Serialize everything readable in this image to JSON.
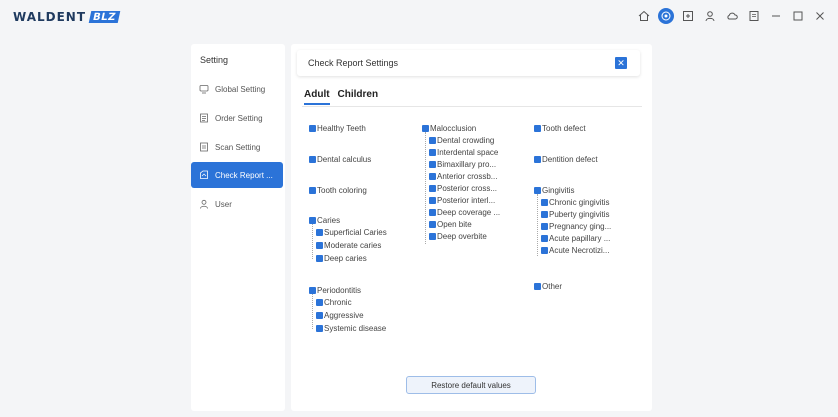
{
  "app": {
    "brand": "WALDENT",
    "brand_badge": "BLZ"
  },
  "top_icons": [
    "home-icon",
    "target-icon",
    "screen-icon",
    "user-icon",
    "cloud-icon",
    "document-icon",
    "minimize-icon",
    "maximize-icon",
    "close-icon"
  ],
  "sidebar": {
    "title": "Setting",
    "items": [
      {
        "label": "Global Setting",
        "icon": "monitor-icon"
      },
      {
        "label": "Order Setting",
        "icon": "list-icon"
      },
      {
        "label": "Scan Setting",
        "icon": "file-icon"
      },
      {
        "label": "Check Report ...",
        "icon": "report-icon",
        "active": true
      },
      {
        "label": "User",
        "icon": "user-icon"
      }
    ]
  },
  "panel": {
    "title": "Check Report Settings",
    "tabs": [
      {
        "label": "Adult",
        "active": true
      },
      {
        "label": "Children",
        "active": false
      }
    ],
    "col1": {
      "healthy": "Healthy Teeth",
      "calculus": "Dental calculus",
      "coloring": "Tooth coloring",
      "caries": "Caries",
      "caries_children": [
        "Superficial Caries",
        "Moderate caries",
        "Deep caries"
      ],
      "perio": "Periodontitis",
      "perio_children": [
        "Chronic",
        "Aggressive",
        "Systemic disease"
      ]
    },
    "col2": {
      "malocclusion": "Malocclusion",
      "malocclusion_children": [
        "Dental crowding",
        "Interdental space",
        "Bimaxillary pro...",
        "Anterior crossb...",
        "Posterior cross...",
        "Posterior interl...",
        "Deep coverage ...",
        "Open bite",
        "Deep overbite"
      ]
    },
    "col3": {
      "tooth_defect": "Tooth defect",
      "dentition_defect": "Dentition defect",
      "gingivitis": "Gingivitis",
      "gingivitis_children": [
        "Chronic gingivitis",
        "Puberty gingivitis",
        "Pregnancy ging...",
        "Acute papillary ...",
        "Acute Necrotizi..."
      ],
      "other": "Other"
    },
    "restore_label": "Restore default values"
  },
  "colors": {
    "accent": "#2b73d8",
    "background": "#f4f5f7"
  }
}
